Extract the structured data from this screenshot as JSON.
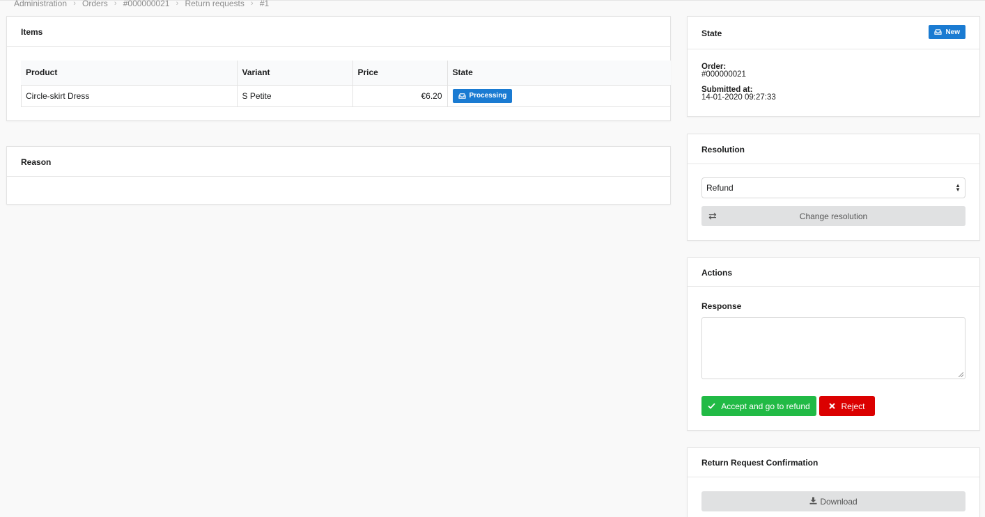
{
  "breadcrumb": [
    "Administration",
    "Orders",
    "#000000021",
    "Return requests",
    "#1"
  ],
  "items": {
    "title": "Items",
    "columns": [
      "Product",
      "Variant",
      "Price",
      "State"
    ],
    "rows": [
      {
        "product": "Circle-skirt Dress",
        "variant": "S Petite",
        "price": "€6.20",
        "state": "Processing"
      }
    ]
  },
  "reason": {
    "title": "Reason"
  },
  "state": {
    "title": "State",
    "badge": "New",
    "order_label": "Order:",
    "order_value": "#000000021",
    "submitted_label": "Submitted at:",
    "submitted_value": "14-01-2020 09:27:33"
  },
  "resolution": {
    "title": "Resolution",
    "selected": "Refund",
    "change_button": "Change resolution"
  },
  "actions": {
    "title": "Actions",
    "response_label": "Response",
    "response_value": "",
    "accept_button": "Accept and go to refund",
    "reject_button": "Reject"
  },
  "confirmation": {
    "title": "Return Request Confirmation",
    "download_button": "Download"
  },
  "colors": {
    "primary": "#1a7bd2",
    "positive": "#21ba45",
    "negative": "#db0000",
    "grey_button": "#e0e1e2"
  },
  "icons": [
    "chevron-right-icon",
    "inbox-icon",
    "exchange-icon",
    "check-icon",
    "times-icon",
    "download-icon"
  ]
}
